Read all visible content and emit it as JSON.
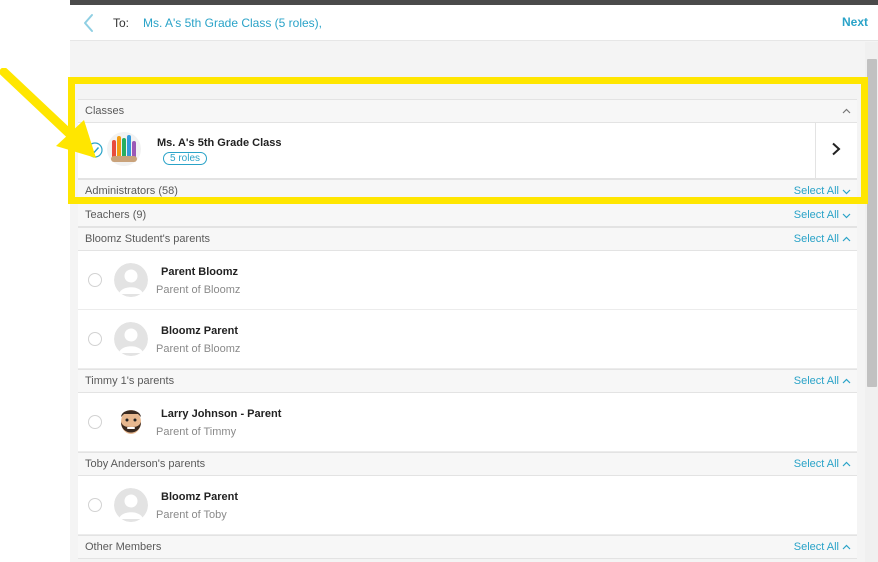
{
  "header": {
    "to_label": "To:",
    "to_value": "Ms. A's 5th Grade Class (5 roles),",
    "next_label": "Next",
    "back_icon": "chevron-left-icon"
  },
  "classes_section": {
    "title": "Classes",
    "item": {
      "name": "Ms. A's 5th Grade Class",
      "roles": "5 roles",
      "checked": true
    }
  },
  "collapsed_sections": [
    {
      "title": "Administrators (58)",
      "select_all": "Select All"
    },
    {
      "title": "Teachers (9)",
      "select_all": "Select All"
    }
  ],
  "groups": [
    {
      "title": "Bloomz Student's parents",
      "select_all": "Select All",
      "members": [
        {
          "name": "Parent Bloomz",
          "sub": "Parent of Bloomz"
        },
        {
          "name": "Bloomz Parent",
          "sub": "Parent of Bloomz"
        }
      ]
    },
    {
      "title": "Timmy 1's parents",
      "select_all": "Select All",
      "members": [
        {
          "name": "Larry Johnson - Parent",
          "sub": "Parent of Timmy"
        }
      ]
    },
    {
      "title": "Toby Anderson's parents",
      "select_all": "Select All",
      "members": [
        {
          "name": "Bloomz Parent",
          "sub": "Parent of Toby"
        }
      ]
    }
  ],
  "other_section": {
    "title": "Other Members",
    "select_all": "Select All"
  },
  "colors": {
    "accent": "#2aa3c8",
    "highlight": "#ffe600",
    "panel_bg": "#f4f4f4"
  }
}
